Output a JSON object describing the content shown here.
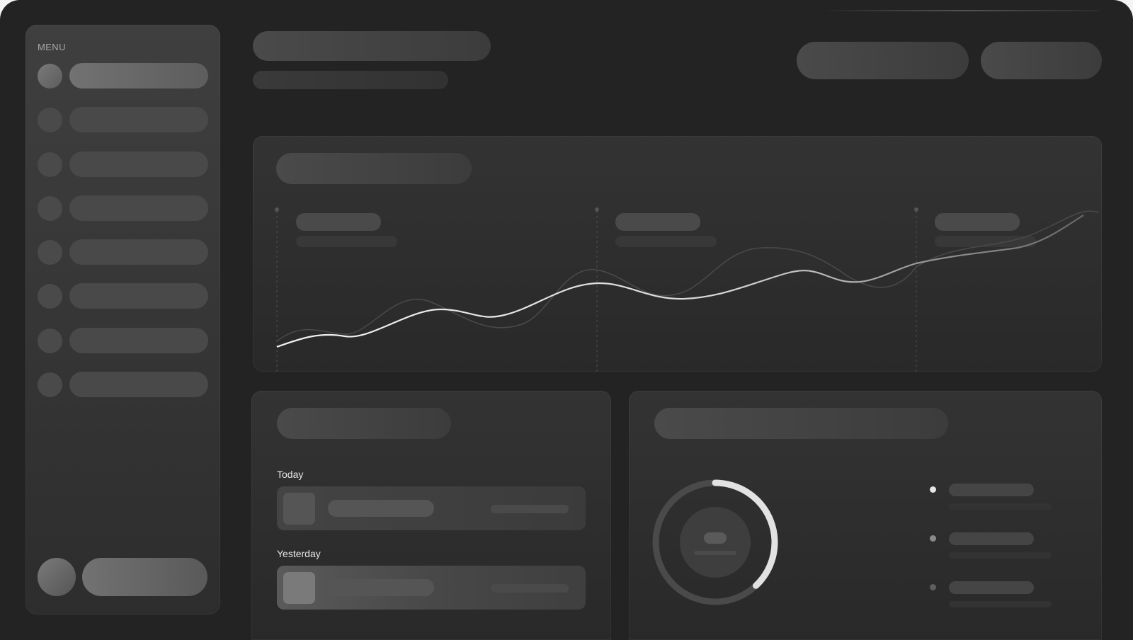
{
  "sidebar": {
    "menu_title": "MENU",
    "items": [
      {
        "state": "active"
      },
      {
        "state": "idle"
      },
      {
        "state": "idle"
      },
      {
        "state": "idle"
      },
      {
        "state": "idle"
      },
      {
        "state": "idle"
      },
      {
        "state": "idle"
      },
      {
        "state": "idle"
      }
    ]
  },
  "activity": {
    "groups": [
      {
        "label": "Today"
      },
      {
        "label": "Yesterday"
      }
    ]
  },
  "chart": {
    "marker_count": 3,
    "line_color": "#e8e8e8"
  },
  "donut": {
    "progress": 0.38,
    "ring_color": "#e2e2e2",
    "track_color": "#4a4a4a",
    "legend_colors": [
      "#e6e6e6",
      "#8a8a8a",
      "#5e5e5e"
    ]
  },
  "colors": {
    "background": "#232323",
    "card": "#2e2e2e",
    "placeholder": "#444444"
  }
}
